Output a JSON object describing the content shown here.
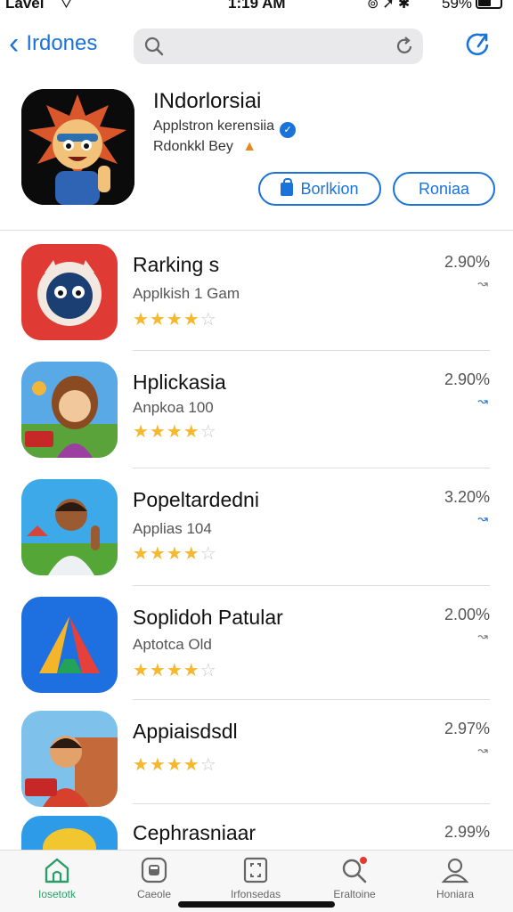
{
  "status_bar": {
    "carrier": "Lavel",
    "time": "1:19 AM",
    "battery": "59%"
  },
  "nav": {
    "back_label": "Irdones",
    "search_placeholder": "",
    "icons": [
      "back-chevron-icon",
      "search-icon",
      "reload-icon",
      "share-icon"
    ]
  },
  "featured": {
    "title": "INdorlorsiai",
    "developer": "Applstron kerensiia",
    "subtitle": "Rdonkkl Bey",
    "button_primary": "Borlkion",
    "button_secondary": "Roniaa"
  },
  "apps": [
    {
      "title": "Rarking s",
      "subtitle": "Applkish 1 Gam",
      "rating": 4.5,
      "stars_text": "★★★★",
      "stars_off": "☆",
      "percent": "2.90%",
      "trend": "↝",
      "trend_color": "gray"
    },
    {
      "title": "Hplickasia",
      "subtitle": "Anpkoa 100",
      "rating": 4.5,
      "stars_text": "★★★★",
      "stars_off": "☆",
      "percent": "2.90%",
      "trend": "↝",
      "trend_color": "blue"
    },
    {
      "title": "Popeltardedni",
      "subtitle": "Applias 104",
      "rating": 4.5,
      "stars_text": "★★★★",
      "stars_off": "☆",
      "percent": "3.20%",
      "trend": "↝",
      "trend_color": "blue"
    },
    {
      "title": "Soplidoh Patular",
      "subtitle": "Aptotca Old",
      "rating": 4.5,
      "stars_text": "★★★★",
      "stars_off": "☆",
      "percent": "2.00%",
      "trend": "↝",
      "trend_color": "gray"
    },
    {
      "title": "Appiaisdsdl",
      "subtitle": "",
      "rating": 4.5,
      "stars_text": "★★★★",
      "stars_off": "☆",
      "percent": "2.97%",
      "trend": "↝",
      "trend_color": "gray"
    },
    {
      "title": "Cephrasniaar",
      "subtitle": "",
      "rating": null,
      "stars_text": "",
      "stars_off": "",
      "percent": "2.99%",
      "trend": "",
      "trend_color": "gray"
    }
  ],
  "tabs": [
    {
      "label": "Iosetotk",
      "icon": "home-icon",
      "active": true
    },
    {
      "label": "Caeole",
      "icon": "games-icon",
      "active": false
    },
    {
      "label": "Irfonsedas",
      "icon": "apps-icon",
      "active": false
    },
    {
      "label": "Eraltoine",
      "icon": "search-icon",
      "active": false
    },
    {
      "label": "Honiara",
      "icon": "profile-icon",
      "active": false
    }
  ],
  "colors": {
    "accent": "#1a73d9",
    "star": "#f5b82e",
    "tab_active": "#2a9d6a",
    "notification_dot": "#e53935"
  }
}
